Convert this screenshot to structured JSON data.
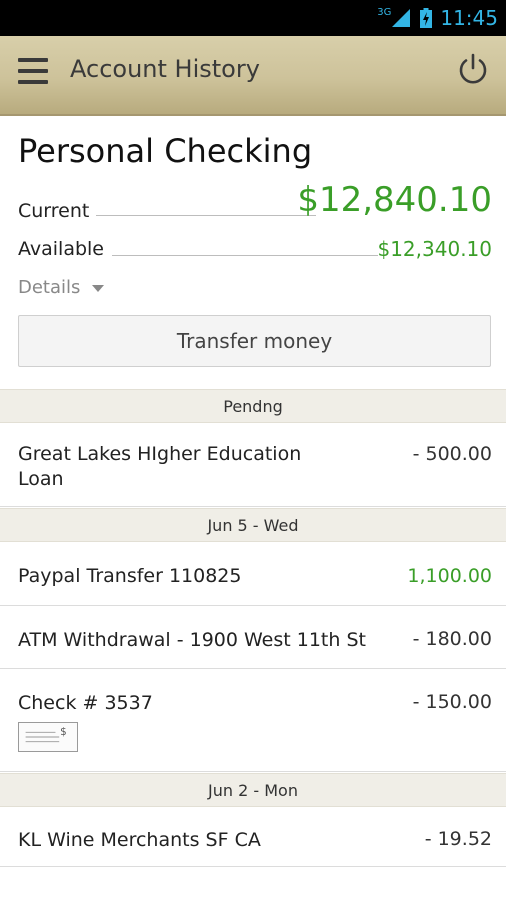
{
  "status_bar": {
    "network": "3G",
    "time": "11:45",
    "icons": [
      "signal-icon",
      "battery-charging-icon"
    ]
  },
  "app_bar": {
    "title": "Account History",
    "menu_icon": "hamburger-menu-icon",
    "power_icon": "power-icon",
    "background": "#cdc29a"
  },
  "account": {
    "name": "Personal Checking",
    "current_label": "Current",
    "current_amount": "$12,840.10",
    "available_label": "Available",
    "available_amount": "$12,340.10",
    "details_label": "Details",
    "transfer_button": "Transfer money",
    "amount_color": "#3a9e28"
  },
  "sections": [
    {
      "header": "Pendng",
      "transactions": [
        {
          "description": "Great Lakes HIgher Education Loan",
          "amount": "- 500.00",
          "type": "debit"
        }
      ]
    },
    {
      "header": "Jun 5 - Wed",
      "transactions": [
        {
          "description": "Paypal Transfer 110825",
          "amount": "1,100.00",
          "type": "credit"
        },
        {
          "description": "ATM Withdrawal - 1900 West 11th St",
          "amount": "- 180.00",
          "type": "debit"
        },
        {
          "description": "Check # 3537",
          "amount": "- 150.00",
          "type": "debit",
          "has_check_image": true,
          "check_icon": "check-image-icon",
          "check_symbol": "$"
        }
      ]
    },
    {
      "header": "Jun 2 - Mon",
      "transactions": [
        {
          "description": "KL Wine Merchants SF CA",
          "amount": "- 19.52",
          "type": "debit"
        }
      ]
    }
  ]
}
